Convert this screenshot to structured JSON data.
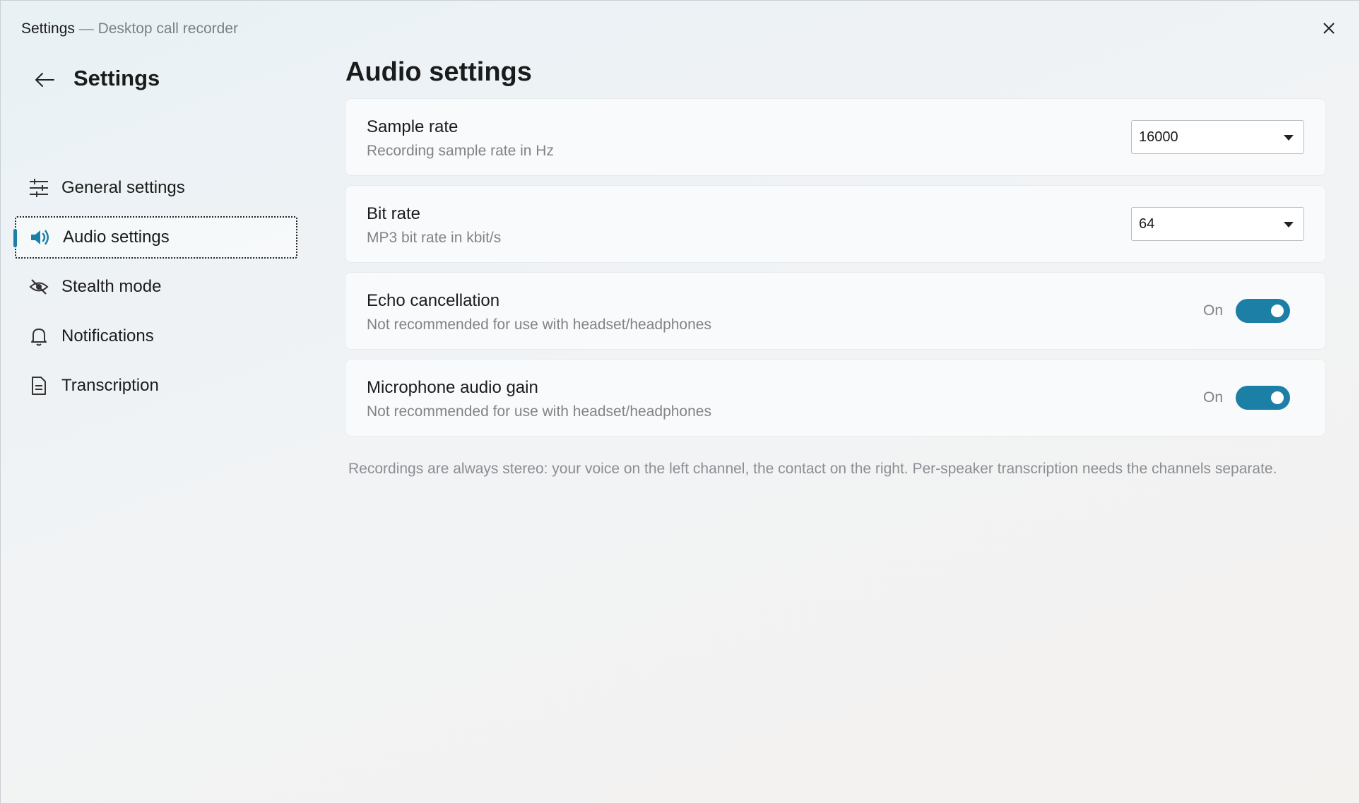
{
  "window": {
    "title": "Settings",
    "separator": " — ",
    "subtitle": "Desktop call recorder",
    "close_icon": "close-icon"
  },
  "sidebar": {
    "back_icon": "arrow-left-icon",
    "title": "Settings",
    "items": [
      {
        "label": "General settings",
        "icon": "sliders-icon",
        "active": false
      },
      {
        "label": "Audio settings",
        "icon": "speaker-icon",
        "active": true
      },
      {
        "label": "Stealth mode",
        "icon": "eye-off-icon",
        "active": false
      },
      {
        "label": "Notifications",
        "icon": "bell-icon",
        "active": false
      },
      {
        "label": "Transcription",
        "icon": "document-icon",
        "active": false
      }
    ]
  },
  "main": {
    "title": "Audio settings",
    "settings": [
      {
        "label": "Sample rate",
        "description": "Recording sample rate in Hz",
        "control": "select",
        "value": "16000"
      },
      {
        "label": "Bit rate",
        "description": "MP3 bit rate in kbit/s",
        "control": "select",
        "value": "64"
      },
      {
        "label": "Echo cancellation",
        "description": "Not recommended for use with headset/headphones",
        "control": "toggle",
        "state_label": "On",
        "on": true
      },
      {
        "label": "Microphone audio gain",
        "description": "Not recommended for use with headset/headphones",
        "control": "toggle",
        "state_label": "On",
        "on": true
      }
    ],
    "note": "Recordings are always stereo: your voice on the left channel, the contact on the right. Per-speaker transcription needs the channels separate."
  },
  "colors": {
    "accent": "#1b7fa6",
    "text": "#1b1b1b",
    "muted": "#808488"
  }
}
